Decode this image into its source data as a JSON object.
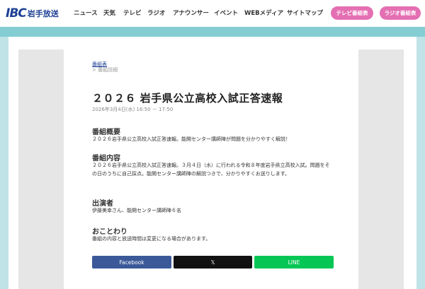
{
  "header": {
    "logo_mark": "IBC",
    "logo_text": "岩手放送",
    "nav": [
      "ニュース",
      "天気",
      "テレビ",
      "ラジオ",
      "アナウンサー",
      "イベント",
      "WEBメディア",
      "サイトマップ"
    ],
    "tv_schedule_btn": "テレビ番組表",
    "radio_schedule_btn": "ラジオ番組表"
  },
  "breadcrumb": {
    "link": "番組表",
    "current": "> 番組詳細"
  },
  "program": {
    "title": "２０２６ 岩手県公立高校入試正答速報",
    "datetime": "2026年3月4日(水) 16:50 － 17:50",
    "sections": [
      {
        "heading": "番組概要",
        "body": "２０２６岩手県公立高校入試正答速報。能開センター講師陣が問題を分かりやすく解説！"
      },
      {
        "heading": "番組内容",
        "body": "２０２６岩手県公立高校入試正答速報。３月４日（水）に行われる令和８年度岩手県立高校入試。問題をその日のうちに自己採点。能開センター講師陣の解説つきで、分かりやすくお送りします。"
      },
      {
        "heading": "出演者",
        "body": "伊藤美幸さん、能開センター講師陣６名"
      },
      {
        "heading": "おことわり",
        "body": "番組の内容と放送時間は変更になる場合があります。"
      }
    ]
  },
  "share": {
    "facebook": "Facebook",
    "x": "𝕏",
    "line": "LINE"
  },
  "colors": {
    "brand": "#1c3f94",
    "pink": "#e46fb2",
    "teal": "#84cdd3",
    "facebook": "#3b5998",
    "x": "#111111",
    "line": "#06c755"
  }
}
